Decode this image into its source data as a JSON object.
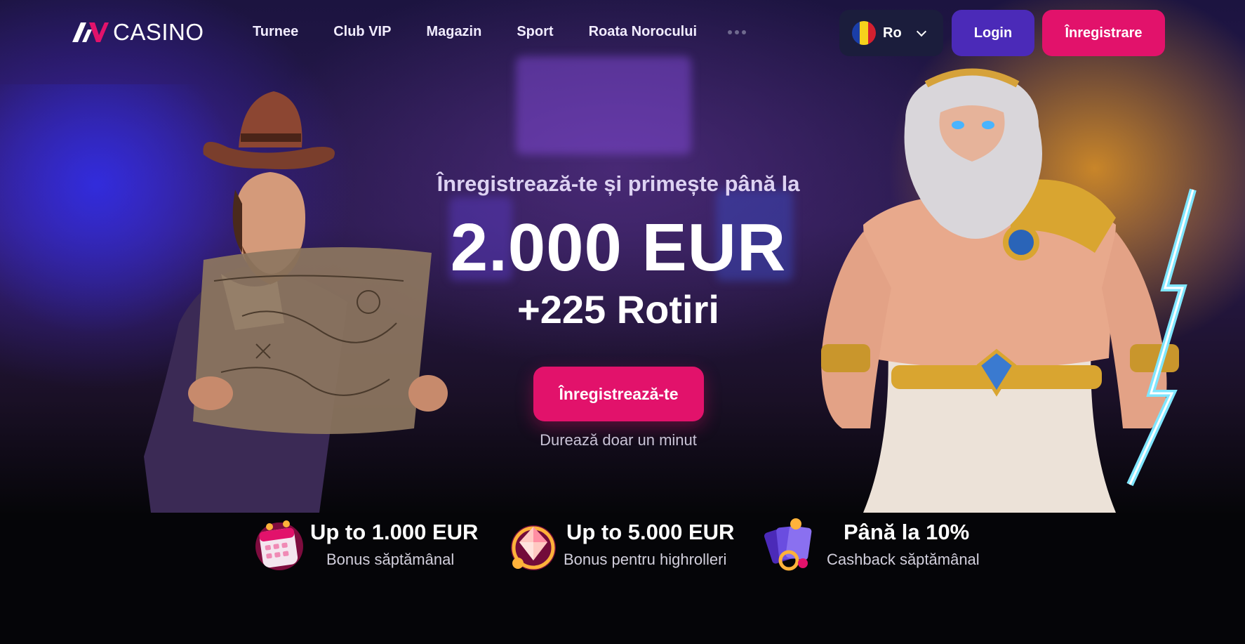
{
  "header": {
    "logo_text": "CASINO",
    "nav": [
      "Turnee",
      "Club VIP",
      "Magazin",
      "Sport",
      "Roata Norocului"
    ],
    "language": "Ro",
    "login_label": "Login",
    "register_label": "Înregistrare"
  },
  "hero": {
    "subtitle": "Înregistrează-te și primește până la",
    "amount": "2.000 EUR",
    "spins": "+225 Rotiri",
    "cta_label": "Înregistrează-te",
    "cta_note": "Durează doar un minut"
  },
  "perks": [
    {
      "title": "Up to 1.000 EUR",
      "description": "Bonus săptămânal",
      "icon": "calendar-icon"
    },
    {
      "title": "Up to 5.000 EUR",
      "description": "Bonus pentru highrolleri",
      "icon": "diamond-icon"
    },
    {
      "title": "Până la 10%",
      "description": "Cashback săptămânal",
      "icon": "cards-icon"
    }
  ],
  "colors": {
    "accent_pink": "#e2126b",
    "login_purple": "#4b2ab8",
    "lang_bg": "#1b1d3c",
    "background": "#050508"
  }
}
